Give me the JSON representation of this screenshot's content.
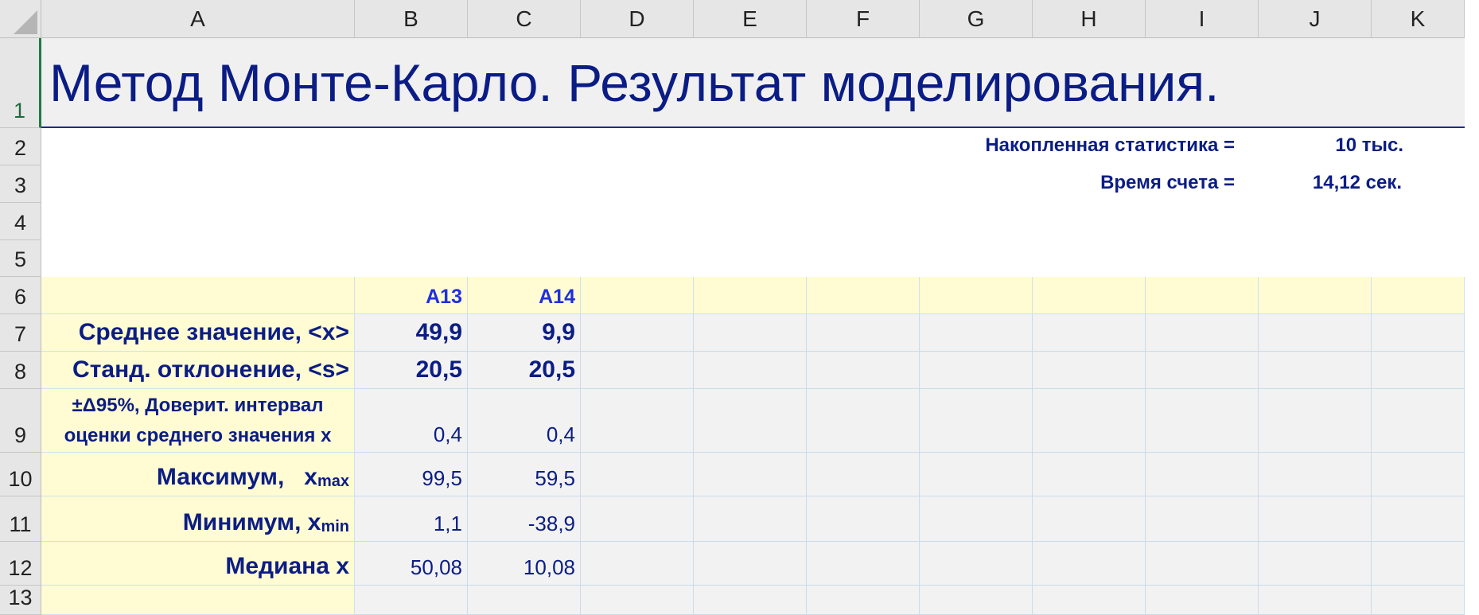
{
  "columns": [
    "A",
    "B",
    "C",
    "D",
    "E",
    "F",
    "G",
    "H",
    "I",
    "J",
    "K"
  ],
  "rows": [
    "1",
    "2",
    "3",
    "4",
    "5",
    "6",
    "7",
    "8",
    "9",
    "10",
    "11",
    "12",
    "13"
  ],
  "title": "Метод Монте-Карло. Результат моделирования.",
  "stats": {
    "accum_label": "Накопленная статистика =",
    "accum_value": "10 тыс.",
    "time_label": "Время счета =",
    "time_value": "14,12 сек."
  },
  "table": {
    "col_headers": [
      "A13",
      "A14"
    ],
    "rows": [
      {
        "label": "Среднее значение, <x>",
        "b": "49,9",
        "c": "9,9"
      },
      {
        "label": "Станд. отклонение, <s>",
        "b": "20,5",
        "c": "20,5"
      },
      {
        "label_line1": "±Δ95%, Доверит. интервал",
        "label_line2": "оценки среднего значения x",
        "b": "0,4",
        "c": "0,4"
      },
      {
        "label": "Максимум,   x",
        "label_sub": "max",
        "b": "99,5",
        "c": "59,5"
      },
      {
        "label": "Минимум, x",
        "label_sub": "min",
        "b": "1,1",
        "c": "-38,9"
      },
      {
        "label": "Медиана x",
        "b": "50,08",
        "c": "10,08"
      }
    ]
  },
  "colors": {
    "title_text": "#0b1d84",
    "yellow_fill": "#fffbd2",
    "header_code": "#1f2fe0",
    "grid_line": "#c8dcec"
  }
}
